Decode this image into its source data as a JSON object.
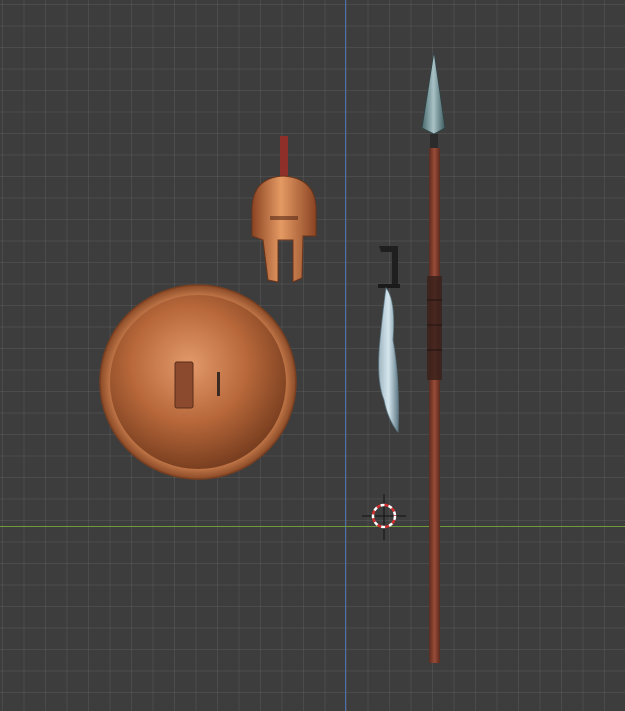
{
  "viewport": {
    "background": "#3d3d3d",
    "grid_color": "#4b4b4b",
    "axis_y_color": "#4a6fae",
    "axis_x_color": "#6e9a3a"
  },
  "objects": [
    {
      "id": "helmet",
      "icon": "corinthian-helmet",
      "color": "#c7713f"
    },
    {
      "id": "shield",
      "icon": "round-bronze-shield",
      "color": "#b8683a"
    },
    {
      "id": "sword",
      "icon": "curved-sword",
      "color": "#7fa0b0"
    },
    {
      "id": "spear",
      "icon": "long-spear",
      "color": "#7a3a2c"
    }
  ],
  "cursor_3d": {
    "icon": "3d-cursor-icon",
    "colors": [
      "#d32f2f",
      "#ffffff"
    ]
  }
}
